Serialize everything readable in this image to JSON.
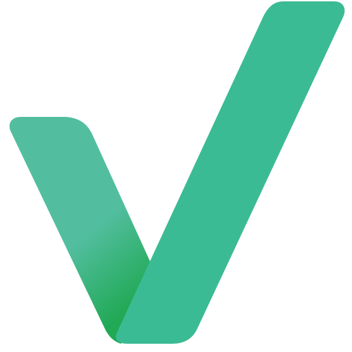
{
  "logo": {
    "name": "checkmark-logo",
    "colors": {
      "left_stroke_top": "#52be9f",
      "left_stroke_bottom": "#21a955",
      "right_stroke": "#3bbb93",
      "background": "#ffffff"
    }
  }
}
